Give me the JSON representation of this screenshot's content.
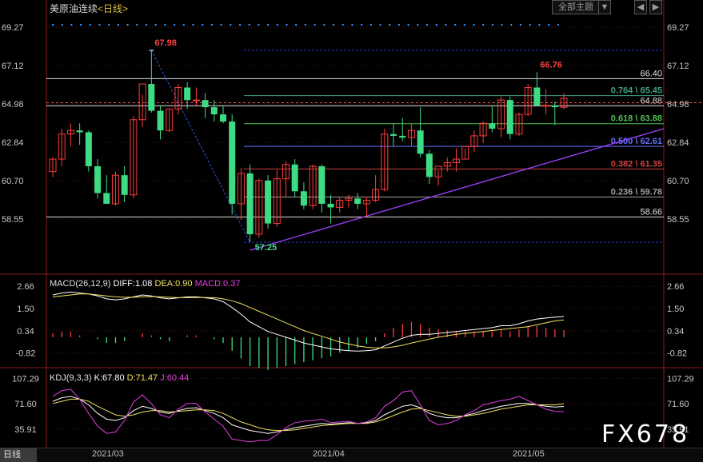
{
  "header": {
    "title": "美原油连续",
    "period": "<日线>",
    "menu_label": "全部主题",
    "menu_arrow": "▼",
    "btn_prev": "◀",
    "btn_next": "▶"
  },
  "price_axis": {
    "range": [
      55.6,
      69.9
    ],
    "ticks": [
      69.27,
      67.12,
      64.98,
      62.84,
      60.7,
      58.55
    ]
  },
  "chart_data": [
    {
      "type": "candlestick",
      "panel": "price",
      "dates_axis_ticks": [
        "2021/03",
        "2021/04",
        "2021/05"
      ],
      "high_annotation": "67.98",
      "low_annotation": "57.25",
      "recent_high_annotation": "66.76",
      "horizontal_levels": [
        {
          "label": "66.40",
          "value": 66.4,
          "color": "#e0e0e0"
        },
        {
          "label": "0.764 \\ 65.45",
          "value": 65.45,
          "color": "#40a080"
        },
        {
          "label": "64.88",
          "value": 64.88,
          "color": "#e0e0e0"
        },
        {
          "label": "0.618 \\ 63.88",
          "value": 63.88,
          "color": "#50c050"
        },
        {
          "label": "0.500 \\ 62.61",
          "value": 62.61,
          "color": "#6070ff"
        },
        {
          "label": "0.382 \\ 61.35",
          "value": 61.35,
          "color": "#d04040"
        },
        {
          "label": "0.236 \\ 59.78",
          "value": 59.78,
          "color": "#a0a0a0"
        },
        {
          "label": "58.66",
          "value": 58.66,
          "color": "#e0e0e0"
        }
      ],
      "candles": [
        [
          61.2,
          62.0,
          60.9,
          61.9
        ],
        [
          61.9,
          63.6,
          61.5,
          63.3
        ],
        [
          63.3,
          63.9,
          62.6,
          63.5
        ],
        [
          63.5,
          63.9,
          62.7,
          63.4
        ],
        [
          63.4,
          63.5,
          61.2,
          61.5
        ],
        [
          61.5,
          61.9,
          59.7,
          60.0
        ],
        [
          60.0,
          61.0,
          59.4,
          59.4
        ],
        [
          59.4,
          61.2,
          59.3,
          61.0
        ],
        [
          61.0,
          61.5,
          59.5,
          59.9
        ],
        [
          59.9,
          64.3,
          59.7,
          64.1
        ],
        [
          64.1,
          65.5,
          63.7,
          66.1
        ],
        [
          66.1,
          67.98,
          64.5,
          64.6
        ],
        [
          64.6,
          64.9,
          63.0,
          63.5
        ],
        [
          63.5,
          64.7,
          63.4,
          64.7
        ],
        [
          64.7,
          66.1,
          64.4,
          65.9
        ],
        [
          65.9,
          66.2,
          64.7,
          65.2
        ],
        [
          65.2,
          65.9,
          64.9,
          65.2
        ],
        [
          65.2,
          65.6,
          64.2,
          64.8
        ],
        [
          64.8,
          65.2,
          64.0,
          64.4
        ],
        [
          64.4,
          64.9,
          63.9,
          64.0
        ],
        [
          64.0,
          64.4,
          58.8,
          59.4
        ],
        [
          59.4,
          61.4,
          58.5,
          61.1
        ],
        [
          61.1,
          61.6,
          57.25,
          57.7
        ],
        [
          57.7,
          60.8,
          57.5,
          60.7
        ],
        [
          60.7,
          61.0,
          58.0,
          58.3
        ],
        [
          58.3,
          61.3,
          58.1,
          60.8
        ],
        [
          60.8,
          61.8,
          59.8,
          61.6
        ],
        [
          61.6,
          61.9,
          59.8,
          60.1
        ],
        [
          60.1,
          60.6,
          59.1,
          59.3
        ],
        [
          59.3,
          61.6,
          59.1,
          61.5
        ],
        [
          61.5,
          61.6,
          58.9,
          59.4
        ],
        [
          59.4,
          59.9,
          58.3,
          59.2
        ],
        [
          59.2,
          59.8,
          58.9,
          59.6
        ],
        [
          59.6,
          59.9,
          59.2,
          59.7
        ],
        [
          59.7,
          60.0,
          59.1,
          59.4
        ],
        [
          59.4,
          59.8,
          58.7,
          59.6
        ],
        [
          59.6,
          61.0,
          59.5,
          60.2
        ],
        [
          60.2,
          63.6,
          60.1,
          63.3
        ],
        [
          63.3,
          63.9,
          62.6,
          63.2
        ],
        [
          63.2,
          64.2,
          62.9,
          63.1
        ],
        [
          63.1,
          63.9,
          62.6,
          63.5
        ],
        [
          63.5,
          64.8,
          62.0,
          62.2
        ],
        [
          62.2,
          62.4,
          60.5,
          60.9
        ],
        [
          60.9,
          61.3,
          60.4,
          61.5
        ],
        [
          61.5,
          62.0,
          61.2,
          61.7
        ],
        [
          61.7,
          62.5,
          61.2,
          61.9
        ],
        [
          61.9,
          62.5,
          61.9,
          62.6
        ],
        [
          62.6,
          63.5,
          62.3,
          63.2
        ],
        [
          63.2,
          64.0,
          62.8,
          63.9
        ],
        [
          63.9,
          64.9,
          63.4,
          63.6
        ],
        [
          63.6,
          65.4,
          63.1,
          65.2
        ],
        [
          65.2,
          65.4,
          63.0,
          63.3
        ],
        [
          63.3,
          64.5,
          63.2,
          64.4
        ],
        [
          64.4,
          66.1,
          64.3,
          65.9
        ],
        [
          65.9,
          66.76,
          64.9,
          64.9
        ],
        [
          64.9,
          65.8,
          64.4,
          64.9
        ],
        [
          64.9,
          65.1,
          63.8,
          64.8
        ],
        [
          64.8,
          65.6,
          64.7,
          65.3
        ]
      ]
    },
    {
      "type": "line",
      "panel": "macd",
      "title": "MACD(26,12,9)",
      "readouts": {
        "diff": "DIFF:1.08",
        "dea": "DEA:0.90",
        "macd": "MACD:0.37"
      },
      "ylim": [
        -1.5,
        3.2
      ],
      "ticks": [
        2.66,
        1.5,
        0.34,
        -0.82
      ],
      "series": [
        {
          "name": "DIFF",
          "color": "#ffffff",
          "values": [
            2.2,
            2.3,
            2.35,
            2.3,
            2.25,
            2.15,
            2.0,
            1.95,
            2.0,
            2.1,
            2.2,
            2.15,
            2.05,
            2.0,
            2.05,
            2.1,
            2.1,
            2.05,
            2.0,
            1.85,
            1.55,
            1.2,
            0.8,
            0.55,
            0.3,
            0.15,
            0.0,
            -0.15,
            -0.3,
            -0.4,
            -0.5,
            -0.6,
            -0.65,
            -0.7,
            -0.72,
            -0.7,
            -0.65,
            -0.45,
            -0.25,
            -0.05,
            0.1,
            0.15,
            0.15,
            0.2,
            0.25,
            0.3,
            0.35,
            0.4,
            0.45,
            0.5,
            0.6,
            0.6,
            0.7,
            0.85,
            0.95,
            1.0,
            1.05,
            1.08
          ]
        },
        {
          "name": "DEA",
          "color": "#f0e060",
          "values": [
            2.1,
            2.15,
            2.2,
            2.25,
            2.25,
            2.2,
            2.15,
            2.1,
            2.08,
            2.08,
            2.1,
            2.12,
            2.1,
            2.08,
            2.06,
            2.06,
            2.07,
            2.07,
            2.06,
            2.0,
            1.9,
            1.75,
            1.55,
            1.35,
            1.15,
            0.95,
            0.75,
            0.55,
            0.35,
            0.2,
            0.05,
            -0.1,
            -0.25,
            -0.35,
            -0.45,
            -0.52,
            -0.55,
            -0.55,
            -0.5,
            -0.42,
            -0.3,
            -0.2,
            -0.1,
            0.0,
            0.08,
            0.15,
            0.2,
            0.25,
            0.3,
            0.35,
            0.4,
            0.45,
            0.5,
            0.55,
            0.65,
            0.75,
            0.85,
            0.9
          ]
        }
      ],
      "histogram": [
        0.2,
        0.3,
        0.3,
        0.1,
        0.0,
        -0.1,
        -0.3,
        -0.3,
        -0.2,
        0.0,
        0.2,
        0.1,
        -0.1,
        -0.2,
        0.0,
        0.1,
        0.1,
        0.0,
        -0.1,
        -0.3,
        -0.7,
        -1.1,
        -1.5,
        -1.6,
        -1.7,
        -1.6,
        -1.5,
        -1.4,
        -1.3,
        -1.2,
        -1.1,
        -1.0,
        -0.8,
        -0.7,
        -0.55,
        -0.35,
        -0.2,
        0.2,
        0.5,
        0.7,
        0.8,
        0.7,
        0.5,
        0.4,
        0.35,
        0.3,
        0.3,
        0.3,
        0.3,
        0.3,
        0.4,
        0.3,
        0.4,
        0.6,
        0.6,
        0.5,
        0.4,
        0.37
      ]
    },
    {
      "type": "line",
      "panel": "kdj",
      "title": "KDJ(9,3,3)",
      "readouts": {
        "k": "K:67.80",
        "d": "D:71.47",
        "j": "J:60.44"
      },
      "ylim": [
        10,
        120
      ],
      "ticks": [
        107.29,
        71.6,
        35.91
      ],
      "series": [
        {
          "name": "K",
          "color": "#ffffff",
          "values": [
            75,
            80,
            82,
            78,
            70,
            58,
            50,
            48,
            52,
            62,
            68,
            65,
            60,
            58,
            62,
            65,
            66,
            62,
            58,
            52,
            42,
            38,
            34,
            32,
            30,
            32,
            35,
            38,
            40,
            42,
            44,
            43,
            44,
            45,
            44,
            45,
            48,
            56,
            62,
            68,
            70,
            66,
            58,
            54,
            52,
            52,
            55,
            58,
            62,
            65,
            68,
            70,
            72,
            72,
            70,
            68,
            67,
            67.8
          ]
        },
        {
          "name": "D",
          "color": "#f0e060",
          "values": [
            72,
            75,
            78,
            78,
            75,
            68,
            62,
            56,
            54,
            56,
            60,
            62,
            62,
            60,
            61,
            62,
            63,
            63,
            62,
            58,
            52,
            46,
            42,
            38,
            35,
            34,
            34,
            35,
            37,
            39,
            41,
            42,
            43,
            44,
            44,
            44,
            46,
            50,
            55,
            60,
            64,
            65,
            62,
            59,
            56,
            54,
            54,
            56,
            58,
            61,
            64,
            66,
            68,
            70,
            70,
            70,
            70,
            71.47
          ]
        },
        {
          "name": "J",
          "color": "#e040e0",
          "values": [
            82,
            90,
            92,
            78,
            58,
            40,
            30,
            32,
            48,
            74,
            84,
            72,
            56,
            52,
            64,
            72,
            72,
            60,
            50,
            40,
            22,
            20,
            18,
            20,
            20,
            28,
            38,
            45,
            47,
            48,
            50,
            45,
            46,
            47,
            44,
            46,
            52,
            68,
            76,
            88,
            90,
            70,
            48,
            42,
            44,
            48,
            56,
            62,
            70,
            73,
            76,
            78,
            82,
            76,
            70,
            64,
            61,
            60.44
          ]
        }
      ]
    }
  ],
  "date_tab": "日线",
  "watermark": "FX678",
  "colors": {
    "up": "#ff3b3b",
    "down": "#3ddc84",
    "axis_text": "#c8c8c8",
    "trend": "#a040ff",
    "dotted": "#3090ff"
  }
}
